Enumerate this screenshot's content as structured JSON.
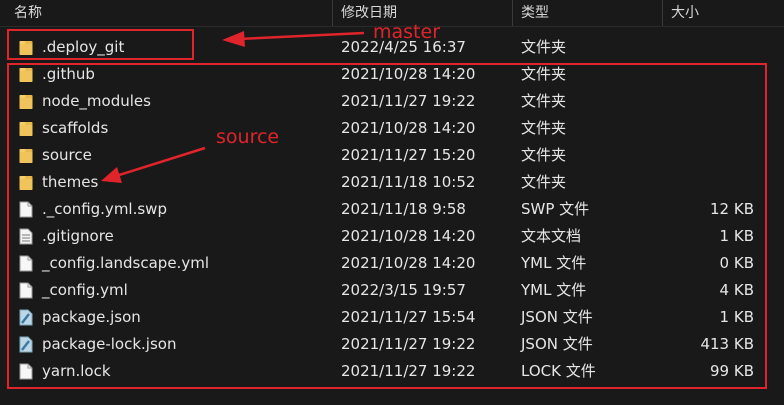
{
  "columns": {
    "name": "名称",
    "date": "修改日期",
    "type": "类型",
    "size": "大小"
  },
  "rows": [
    {
      "name": ".deploy_git",
      "date": "2022/4/25 16:37",
      "type": "文件夹",
      "size": "",
      "icon": "folder-icon"
    },
    {
      "name": ".github",
      "date": "2021/10/28 14:20",
      "type": "文件夹",
      "size": "",
      "icon": "folder-icon"
    },
    {
      "name": "node_modules",
      "date": "2021/11/27 19:22",
      "type": "文件夹",
      "size": "",
      "icon": "folder-icon"
    },
    {
      "name": "scaffolds",
      "date": "2021/10/28 14:20",
      "type": "文件夹",
      "size": "",
      "icon": "folder-icon"
    },
    {
      "name": "source",
      "date": "2021/11/27 15:20",
      "type": "文件夹",
      "size": "",
      "icon": "folder-icon"
    },
    {
      "name": "themes",
      "date": "2021/11/18 10:52",
      "type": "文件夹",
      "size": "",
      "icon": "folder-icon"
    },
    {
      "name": "._config.yml.swp",
      "date": "2021/11/18 9:58",
      "type": "SWP 文件",
      "size": "12 KB",
      "icon": "file-icon"
    },
    {
      "name": ".gitignore",
      "date": "2021/10/28 14:20",
      "type": "文本文档",
      "size": "1 KB",
      "icon": "text-file-icon"
    },
    {
      "name": "_config.landscape.yml",
      "date": "2021/10/28 14:20",
      "type": "YML 文件",
      "size": "0 KB",
      "icon": "file-icon"
    },
    {
      "name": "_config.yml",
      "date": "2022/3/15 19:57",
      "type": "YML 文件",
      "size": "4 KB",
      "icon": "file-icon"
    },
    {
      "name": "package.json",
      "date": "2021/11/27 15:54",
      "type": "JSON 文件",
      "size": "1 KB",
      "icon": "json-file-icon"
    },
    {
      "name": "package-lock.json",
      "date": "2021/11/27 19:22",
      "type": "JSON 文件",
      "size": "413 KB",
      "icon": "json-file-icon"
    },
    {
      "name": "yarn.lock",
      "date": "2021/11/27 19:22",
      "type": "LOCK 文件",
      "size": "99 KB",
      "icon": "file-icon"
    }
  ],
  "annotations": {
    "master": "master",
    "source": "source"
  },
  "colors": {
    "background": "#191919",
    "annotation": "#e0242c",
    "folder": "#e8b94a"
  }
}
